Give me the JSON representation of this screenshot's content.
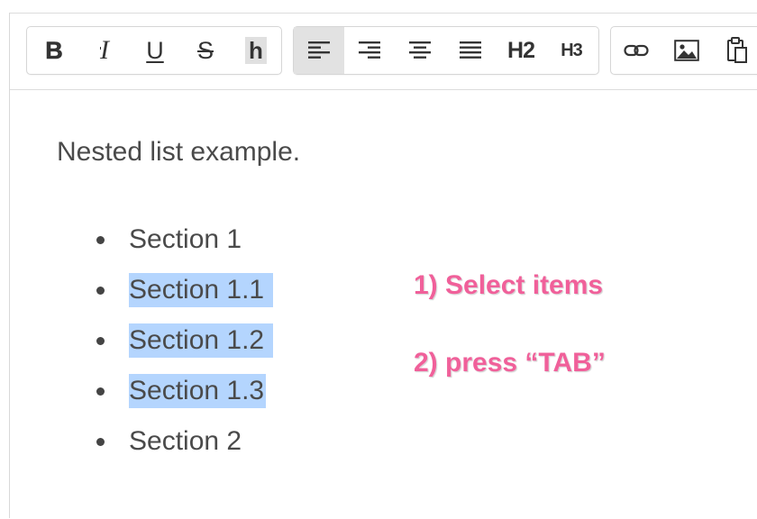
{
  "toolbar": {
    "format": {
      "bold": "B",
      "italic": "I",
      "underline": "U",
      "strikethrough": "S",
      "highlight": "h"
    },
    "headings": {
      "h2": "H2",
      "h3": "H3"
    }
  },
  "content": {
    "paragraph": "Nested list example.",
    "list": [
      {
        "text": "Section 1",
        "selected": false
      },
      {
        "text": "Section 1.1",
        "selected": true
      },
      {
        "text": "Section 1.2",
        "selected": true
      },
      {
        "text": "Section 1.3",
        "selected": true
      },
      {
        "text": "Section 2",
        "selected": false
      }
    ]
  },
  "annotations": {
    "step1": "1) Select items",
    "step2": "2) press “TAB”"
  },
  "colors": {
    "selection": "#b4d5fe",
    "annotation": "#f0609a",
    "active_button": "#e2e2e2"
  }
}
